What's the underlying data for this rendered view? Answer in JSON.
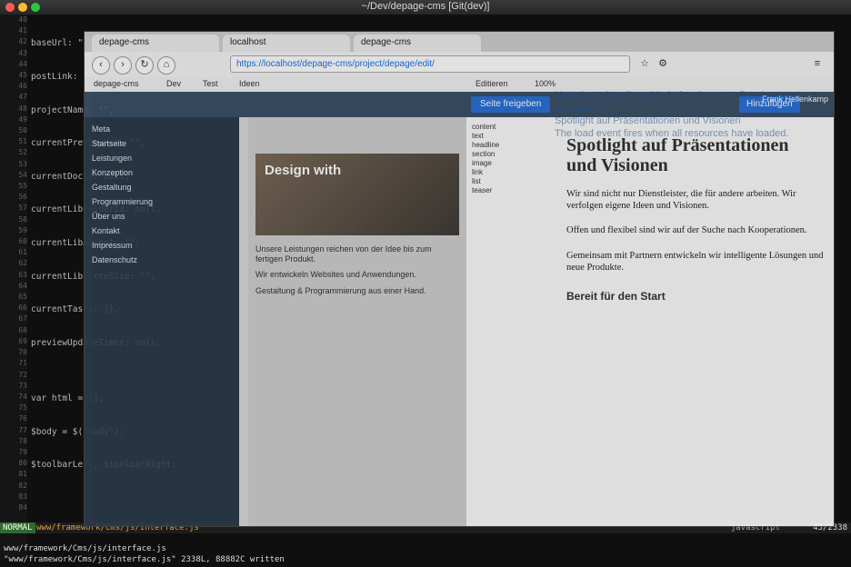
{
  "window": {
    "title": "~/Dev/depage-cms [Git(dev)]"
  },
  "editor": {
    "code_lines": [
      "baseUrl: \"\",",
      "postLink: \"\",",
      "projectName: \"\",",
      "currentPreviewUrl: \"\",",
      "currentDocId: null,",
      "currentLibFolderId: null,",
      "currentLibAccept: \"\",",
      "currentLibForceSize: \"\",",
      "currentTasks: {},",
      "previewUpdateTimer: null,",
      "",
      "var html = [];",
      "$body = $(\"body\");",
      "$toolbarLeft, $toolbarRight;"
    ],
    "status": {
      "mode": "NORMAL",
      "file": "www/framework/Cms/js/interface.js",
      "filetype": "javascript",
      "position": "43/2338"
    },
    "messages": [
      "www/framework/Cms/js/interface.js",
      "\"www/framework/Cms/js/interface.js\" 2338L, 88882C written"
    ]
  },
  "browser": {
    "tabs": [
      "depage-cms",
      "localhost",
      "depage-cms"
    ],
    "url": "https://localhost/depage-cms/project/depage/edit/",
    "bookmarks": [
      "depage-cms",
      "Dev",
      "Test",
      "Ideen",
      "Editieren",
      "100%"
    ],
    "toolbar_icons": [
      "back-icon",
      "forward-icon",
      "reload-icon",
      "home-icon",
      "star-icon",
      "menu-icon"
    ]
  },
  "cms": {
    "publish_label": "Seite freigeben",
    "add_label": "Hinzufügen",
    "user": "Frank Hellenkamp",
    "tree_items": [
      "Meta",
      "Startseite",
      "Leistungen",
      "Konzeption",
      "Gestaltung",
      "Programmierung",
      "Über uns",
      "Kontakt",
      "Impressum",
      "Datenschutz"
    ],
    "preview": {
      "hero_title": "Design with",
      "texts": [
        "Unsere Leistungen reichen von der Idee bis zum fertigen Produkt.",
        "Wir entwickeln Websites und Anwendungen.",
        "Gestaltung & Programmierung aus einer Hand."
      ]
    },
    "doc": {
      "list": [
        "content",
        "text",
        "headline",
        "section",
        "image",
        "link",
        "list",
        "teaser"
      ],
      "heading": "Spotlight auf Präsentationen und Visionen",
      "paragraphs": [
        "Wir sind nicht nur Dienstleister, die für andere arbeiten. Wir verfolgen eigene Ideen und Visionen.",
        "Offen und flexibel sind wir auf der Suche nach Kooperationen.",
        "Gemeinsam mit Partnern entwickeln wir intelligente Lösungen und neue Produkte."
      ],
      "subhead": "Bereit für den Start"
    },
    "mdn_overlay": [
      "Note that a handler added after the event fires is never executed.",
      "Spotlight auf Präsentationen und Visionen",
      "The load event fires when all resources have loaded."
    ]
  }
}
